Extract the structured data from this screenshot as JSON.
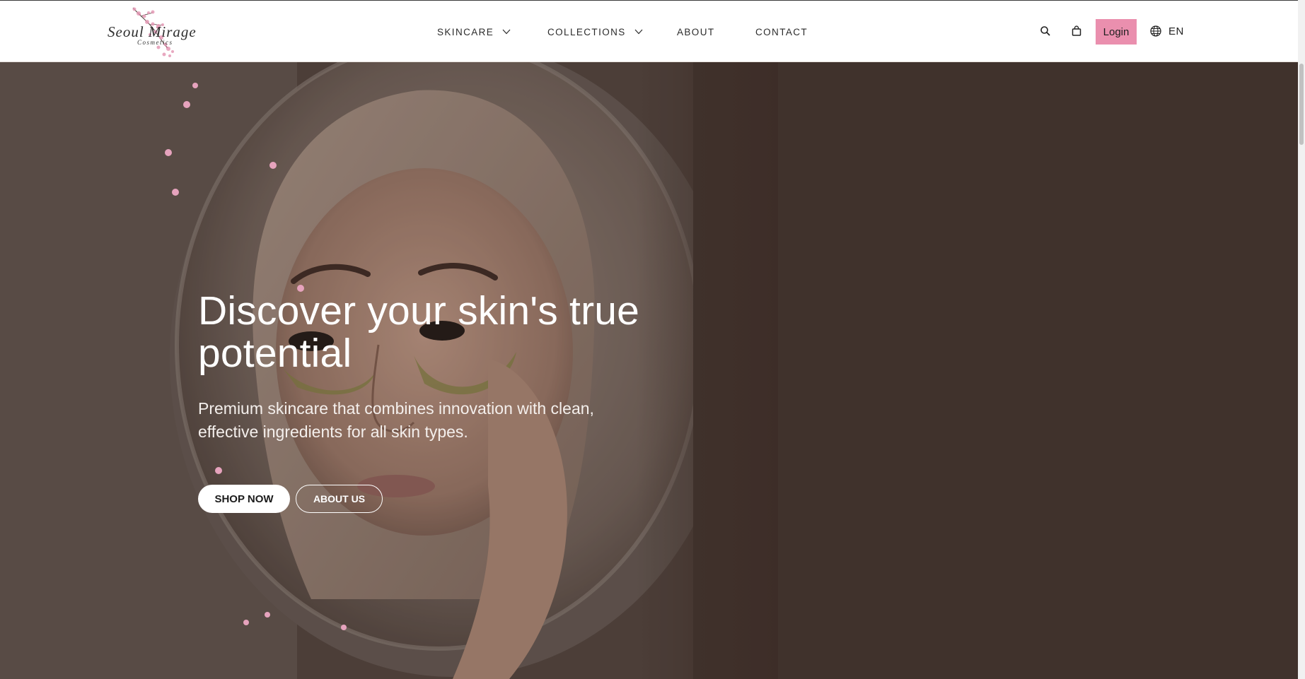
{
  "brand": {
    "name": "Seoul Mirage",
    "tagline": "Cosmetics"
  },
  "nav": {
    "items": [
      {
        "label": "SKINCARE",
        "has_dropdown": true
      },
      {
        "label": "COLLECTIONS",
        "has_dropdown": true
      },
      {
        "label": "ABOUT",
        "has_dropdown": false
      },
      {
        "label": "CONTACT",
        "has_dropdown": false
      }
    ]
  },
  "header_actions": {
    "search_icon": "search-icon",
    "cart_icon": "shopping-bag-icon",
    "login_label": "Login",
    "language_icon": "globe-icon",
    "language_label": "EN"
  },
  "hero": {
    "title": "Discover your skin's true potential",
    "subtitle": "Premium skincare that combines innovation with clean, effective ingredients for all skin types.",
    "primary_button": "SHOP NOW",
    "secondary_button": "ABOUT US"
  },
  "colors": {
    "accent": "#ea8fae",
    "hero_background": "#4e3c35",
    "header_background": "#ffffff",
    "nav_text": "#2b2b2b"
  }
}
